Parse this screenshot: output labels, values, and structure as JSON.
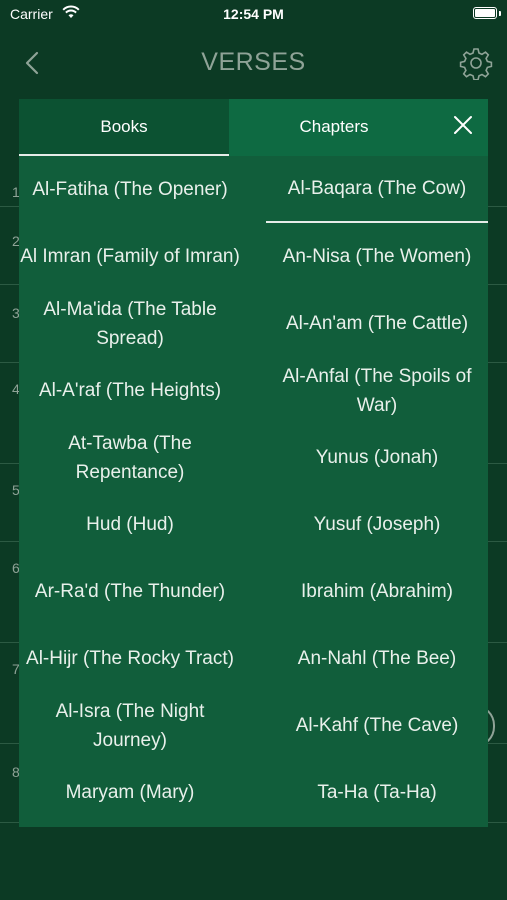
{
  "status_bar": {
    "carrier": "Carrier",
    "time": "12:54 PM"
  },
  "nav": {
    "title": "VERSES"
  },
  "background_rows": [
    "1",
    "2",
    "3",
    "4",
    "5",
    "6",
    "7",
    "8"
  ],
  "picker": {
    "tabs": {
      "books": "Books",
      "chapters": "Chapters"
    },
    "books": [
      "Al-Fatiha (The Opener)",
      "Al Imran (Family of Imran)",
      "Al-Ma'ida (The Table Spread)",
      "Al-A'raf (The Heights)",
      "At-Tawba (The Repentance)",
      "Hud (Hud)",
      "Ar-Ra'd (The Thunder)",
      "Al-Hijr (The Rocky Tract)",
      "Al-Isra (The Night Journey)",
      "Maryam (Mary)"
    ],
    "chapters": [
      "Al-Baqara (The Cow)",
      "An-Nisa (The Women)",
      "Al-An'am (The Cattle)",
      "Al-Anfal (The Spoils of War)",
      "Yunus (Jonah)",
      "Yusuf (Joseph)",
      "Ibrahim (Abrahim)",
      "An-Nahl (The Bee)",
      "Al-Kahf (The Cave)",
      "Ta-Ha (Ta-Ha)"
    ],
    "selected_chapter": "Al-Baqara (The Cow)"
  },
  "colors": {
    "background": "#0c3a24",
    "panel": "#115e3b",
    "tab_active": "#0c5232",
    "tab_inactive": "#0e6a42",
    "text": "#ffffff",
    "muted_text": "#8fa397"
  },
  "icons": [
    "wifi-icon",
    "battery-icon",
    "back-chevron-icon",
    "gear-icon",
    "close-icon"
  ]
}
